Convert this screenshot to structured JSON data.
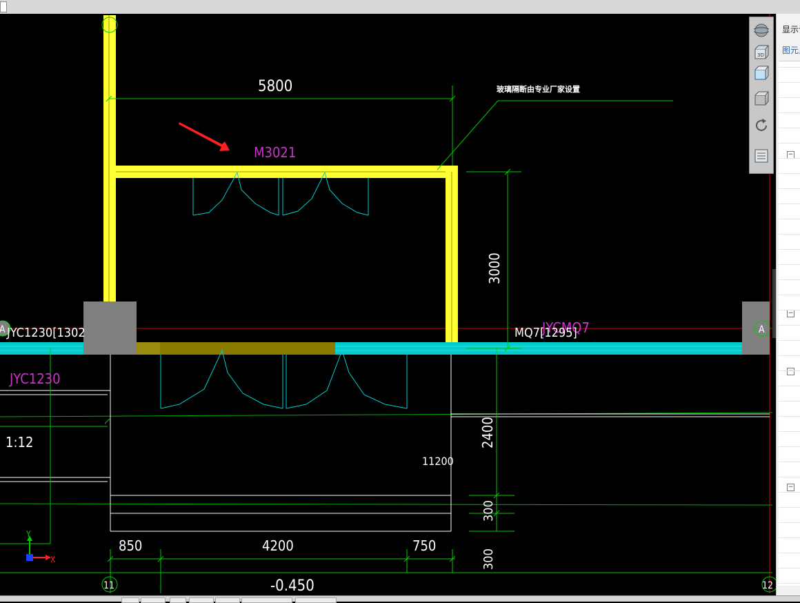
{
  "drawing": {
    "dim_top": "5800",
    "dim_right_vertical": "3000",
    "leader_note": "玻璃隔断由专业厂家设置",
    "door_label": "M3021",
    "window_left_label": "JYC1230[1302",
    "window_left_tag": "JYC1230",
    "curtain_label": "MQ7[1295]",
    "curtain_tag": "JYCMQ7",
    "scale_text": "1:12",
    "length_label": "11200",
    "dim_2400": "2400",
    "dim_300a": "300",
    "dim_300b": "300",
    "dim_850": "850",
    "dim_4200": "4200",
    "dim_750": "750",
    "elevation": "-0.450",
    "axis_a_left": "A",
    "axis_a_right": "A",
    "axis_11": "11",
    "axis_12": "12",
    "ucs_x": "X",
    "ucs_y": "Y"
  },
  "right_panel": {
    "tab_display": "显示设置",
    "tab_elements": "图元显示"
  },
  "colors": {
    "wall": "#ffff33",
    "window": "#00cccc",
    "dimension": "#00cc00",
    "text_magenta": "#cc33cc",
    "axis_red": "#ff0000",
    "column": "#808080"
  }
}
